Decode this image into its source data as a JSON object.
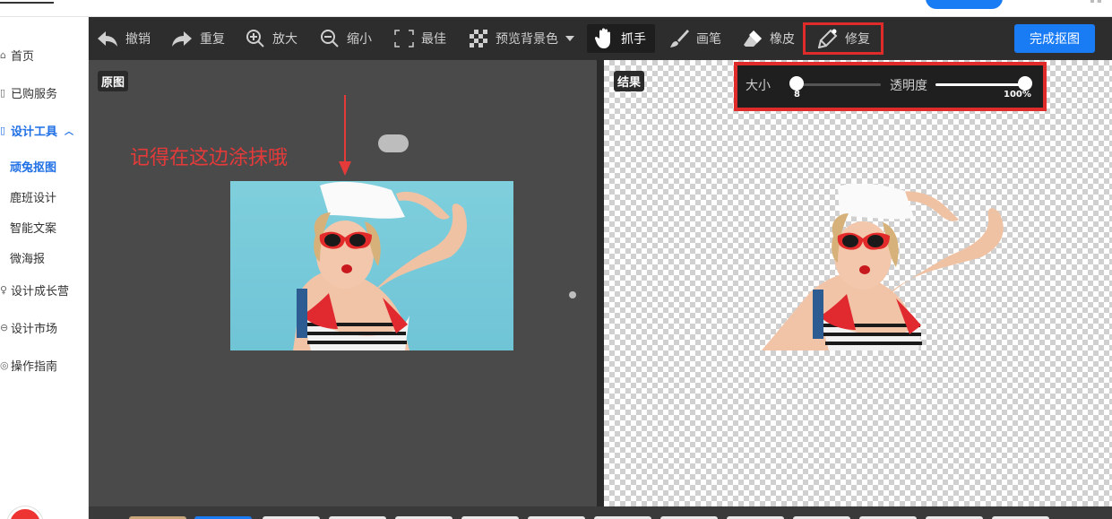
{
  "sidebar": {
    "items": [
      {
        "label": "首页",
        "icon": "home-icon"
      },
      {
        "label": "已购服务",
        "icon": "service-icon"
      },
      {
        "label": "设计工具",
        "icon": "design-tools-icon",
        "expanded": true
      },
      {
        "label": "设计成长营",
        "icon": "growth-icon"
      },
      {
        "label": "设计市场",
        "icon": "market-icon"
      },
      {
        "label": "操作指南",
        "icon": "guide-icon"
      }
    ],
    "subitems": [
      {
        "label": "顽兔抠图",
        "active": true
      },
      {
        "label": "鹿班设计"
      },
      {
        "label": "智能文案"
      },
      {
        "label": "微海报"
      }
    ]
  },
  "toolbar": {
    "undo": "撤销",
    "redo": "重复",
    "zoom_in": "放大",
    "zoom_out": "缩小",
    "best": "最佳",
    "preview_bg": "预览背景色",
    "hand": "抓手",
    "brush": "画笔",
    "eraser": "橡皮",
    "repair": "修复",
    "done": "完成抠图"
  },
  "canvas": {
    "original_label": "原图",
    "result_label": "结果",
    "annotation": "记得在这边涂抹哦"
  },
  "slider_panel": {
    "size_label": "大小",
    "size_value": "8",
    "size_level": 0.0,
    "opacity_label": "透明度",
    "opacity_value": "100%",
    "opacity_level": 1.0
  },
  "colors": {
    "accent": "#1a7cf5",
    "highlight": "#e02b2b",
    "toolbar_bg": "#2d2d2d",
    "canvas_bg": "#4a4a4a"
  }
}
